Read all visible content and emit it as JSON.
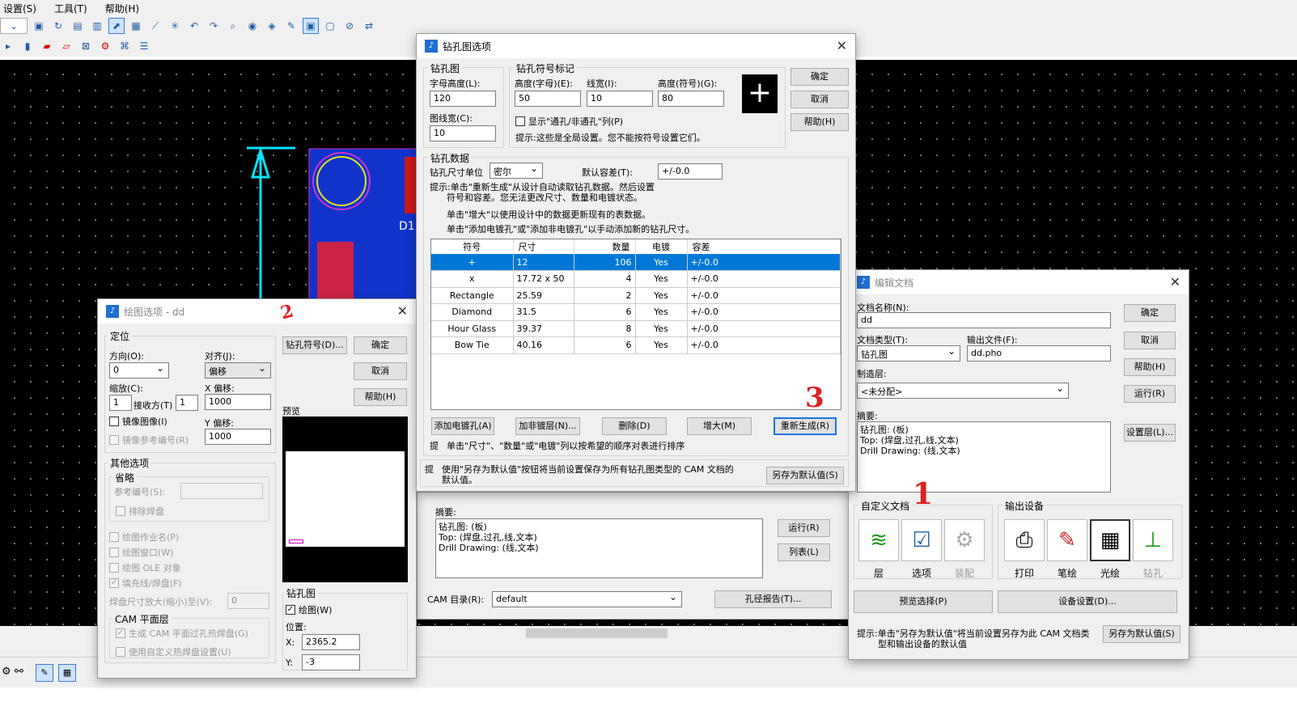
{
  "menubar": {
    "items": [
      "设置(S)",
      "工具(T)",
      "帮助(H)"
    ]
  },
  "drill_dialog": {
    "title": "钻孔图选项",
    "drill_group": "钻孔图",
    "char_height_label": "字母高度(L):",
    "char_height": "120",
    "line_width_label": "图线宽(C):",
    "line_width": "10",
    "symbol_group": "钻孔符号标记",
    "sym_height_char_label": "高度(字母)(E):",
    "sym_height_char": "50",
    "sym_line_label": "线宽(I):",
    "sym_line": "10",
    "sym_height_label": "高度(符号)(G):",
    "sym_height": "80",
    "show_plated_label": "显示\"通孔/非通孔\"列(P)",
    "global_hint": "提示:这些是全局设置。您不能按符号设置它们。",
    "ok": "确定",
    "cancel": "取消",
    "help": "帮助(H)",
    "data_group": "钻孔数据",
    "unit_label": "钻孔尺寸单位",
    "unit_value": "密尔",
    "tolerance_label": "默认容差(T):",
    "tolerance_value": "+/-0.0",
    "hint1": "提示:单击\"重新生成\"从设计自动读取钻孔数据。然后设置",
    "hint2": "符号和容差。您无法更改尺寸、数量和电镀状态。",
    "hint3": "单击\"增大\"以使用设计中的数据更新现有的表数据。",
    "hint4": "单击\"添加电镀孔\"或\"添加非电镀孔\"以手动添加新的钻孔尺寸。",
    "columns": [
      "符号",
      "尺寸",
      "数量",
      "电镀",
      "容差"
    ],
    "rows": [
      [
        "+",
        "12",
        "106",
        "Yes",
        "+/-0.0"
      ],
      [
        "x",
        "17.72 x 50",
        "4",
        "Yes",
        "+/-0.0"
      ],
      [
        "Rectangle",
        "25.59",
        "2",
        "Yes",
        "+/-0.0"
      ],
      [
        "Diamond",
        "31.5",
        "6",
        "Yes",
        "+/-0.0"
      ],
      [
        "Hour Glass",
        "39.37",
        "8",
        "Yes",
        "+/-0.0"
      ],
      [
        "Bow Tie",
        "40.16",
        "6",
        "Yes",
        "+/-0.0"
      ]
    ],
    "add_plated": "添加电镀孔(A)",
    "add_nonplated": "加非镀层(N)...",
    "delete": "删除(D)",
    "increase": "增大(M)",
    "regenerate": "重新生成(R)",
    "sort_prefix": "提",
    "sort_hint": "单击\"尺寸\"、\"数量\"或\"电镀\"列以按希望的顺序对表进行排序",
    "bottom_prefix": "提",
    "bottom_hint1": "使用\"另存为默认值\"按钮将当前设置保存为所有钻孔图类型的 CAM 文档的",
    "bottom_hint2": "默认值。",
    "save_default": "另存为默认值(S)"
  },
  "plot_dialog": {
    "title": "绘图选项 - dd",
    "position_group": "定位",
    "direction_label": "方向(O):",
    "direction_value": "0",
    "align_label": "对齐(J):",
    "align_value": "偏移",
    "scale_label": "缩放(C):",
    "scale_a": "1",
    "scale_mid": "接收方(T)",
    "scale_b": "1",
    "xoff_label": "X 偏移:",
    "xoff": "1000",
    "yoff_label": "Y 偏移:",
    "yoff": "1000",
    "mirror": "镜像图像(I)",
    "mirror_ref": "镜像参考编号(R)",
    "drill_symbol_btn": "钻孔符号(D)...",
    "ok": "确定",
    "cancel": "取消",
    "help": "帮助(H)",
    "preview_label": "预览",
    "other_group": "其他选项",
    "omit_group": "省略",
    "ref_label": "参考编号(S):",
    "exclude_pad": "排除焊盘",
    "plot_job": "绘图作业名(P)",
    "plot_window": "绘图窗口(W)",
    "plot_ole": "绘图 OLE 对象",
    "fill": "填充线/焊盘(F)",
    "pad_label": "焊盘尺寸放大(缩小)至(V):",
    "pad_value": "0",
    "cam_group": "CAM 平面层",
    "cam_gen": "生成 CAM 平面过孔热焊盘(G)",
    "cam_custom": "使用自定义热焊盘设置(U)",
    "drill_group": "钻孔图",
    "drill_chk": "绘图(W)",
    "pos_label": "位置:",
    "x_label": "X:",
    "x": "2365.2",
    "y_label": "Y:",
    "y": "-3"
  },
  "edit_dialog": {
    "title": "编辑文档",
    "name_label": "文档名称(N):",
    "name": "dd",
    "type_label": "文档类型(T):",
    "type": "钻孔图",
    "out_label": "输出文件(F):",
    "out": "dd.pho",
    "layer_label": "制造层:",
    "layer": "<未分配>",
    "summary_label": "摘要:",
    "summary": "钻孔图: (板)\nTop: (焊盘,过孔,线,文本)\nDrill Drawing: (线,文本)",
    "ok": "确定",
    "cancel": "取消",
    "help": "帮助(H)",
    "run": "运行(R)",
    "set_layer": "设置层(L)...",
    "custom_group": "自定义文档",
    "c1": "层",
    "c2": "选项",
    "c3": "装配",
    "output_group": "输出设备",
    "o1": "打印",
    "o2": "笔绘",
    "o3": "光绘",
    "o4": "钻孔",
    "preview_btn": "预览选择(P)",
    "device_btn": "设备设置(D)...",
    "hint1": "提示:单击\"另存为默认值\"将当前设置另存为此 CAM 文档类",
    "hint2": "型和输出设备的默认值",
    "save_default": "另存为默认值(S)"
  },
  "cam_dialog": {
    "summary_label": "摘要:",
    "summary": "钻孔图: (板)\nTop: (焊盘,过孔,线,文本)\nDrill Drawing: (线,文本)",
    "run": "运行(R)",
    "list": "列表(L)",
    "dir_label": "CAM 目录(R):",
    "dir": "default",
    "hole_report": "孔径报告(T)..."
  },
  "annotations": {
    "a1": "2",
    "a2": "3",
    "a3": "1"
  }
}
